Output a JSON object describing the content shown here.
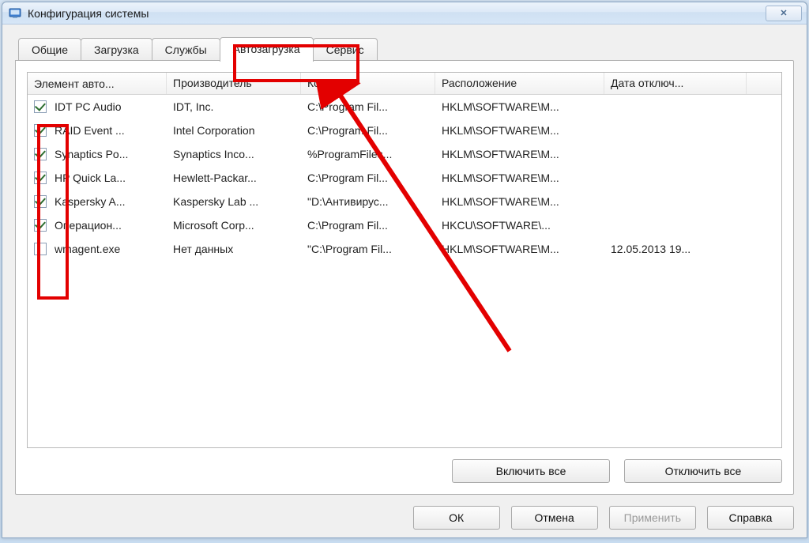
{
  "window": {
    "title": "Конфигурация системы",
    "close_glyph": "✕"
  },
  "tabs": [
    {
      "label": "Общие"
    },
    {
      "label": "Загрузка"
    },
    {
      "label": "Службы"
    },
    {
      "label": "Автозагрузка"
    },
    {
      "label": "Сервис"
    }
  ],
  "active_tab_index": 3,
  "columns": [
    {
      "label": "Элемент авто..."
    },
    {
      "label": "Производитель"
    },
    {
      "label": "Команда"
    },
    {
      "label": "Расположение"
    },
    {
      "label": "Дата отключ..."
    }
  ],
  "rows": [
    {
      "checked": true,
      "item": "IDT PC Audio",
      "vendor": "IDT, Inc.",
      "cmd": "C:\\Program Fil...",
      "loc": "HKLM\\SOFTWARE\\M...",
      "date": ""
    },
    {
      "checked": true,
      "item": "RAID Event ...",
      "vendor": "Intel Corporation",
      "cmd": "C:\\Program Fil...",
      "loc": "HKLM\\SOFTWARE\\M...",
      "date": ""
    },
    {
      "checked": true,
      "item": "Synaptics Po...",
      "vendor": "Synaptics Inco...",
      "cmd": "%ProgramFiles...",
      "loc": "HKLM\\SOFTWARE\\M...",
      "date": ""
    },
    {
      "checked": true,
      "item": "HP Quick La...",
      "vendor": "Hewlett-Packar...",
      "cmd": "C:\\Program Fil...",
      "loc": "HKLM\\SOFTWARE\\M...",
      "date": ""
    },
    {
      "checked": true,
      "item": "Kaspersky A...",
      "vendor": "Kaspersky Lab ...",
      "cmd": "\"D:\\Антивирус...",
      "loc": "HKLM\\SOFTWARE\\M...",
      "date": ""
    },
    {
      "checked": true,
      "item": "Операцион...",
      "vendor": "Microsoft Corp...",
      "cmd": "C:\\Program Fil...",
      "loc": "HKCU\\SOFTWARE\\...",
      "date": ""
    },
    {
      "checked": false,
      "item": "wmagent.exe",
      "vendor": "Нет данных",
      "cmd": "\"C:\\Program Fil...",
      "loc": "HKLM\\SOFTWARE\\M...",
      "date": "12.05.2013 19..."
    }
  ],
  "buttons": {
    "enable_all": "Включить все",
    "disable_all": "Отключить все",
    "ok": "ОК",
    "cancel": "Отмена",
    "apply": "Применить",
    "help": "Справка"
  }
}
